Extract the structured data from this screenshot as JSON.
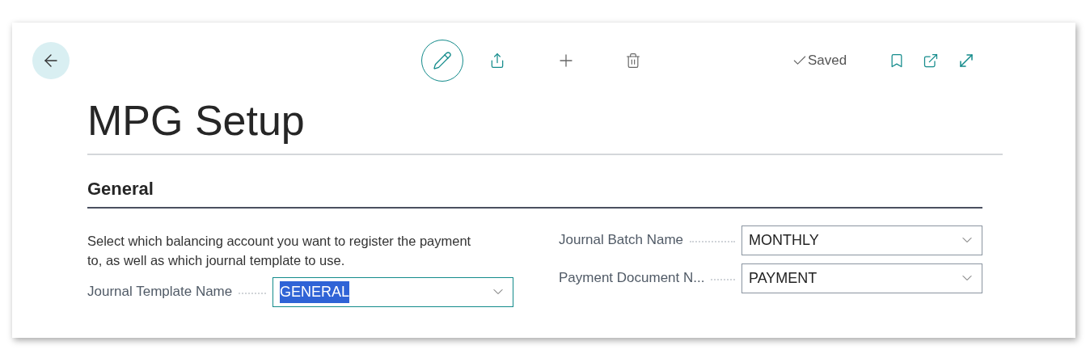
{
  "toolbar": {
    "status": "Saved"
  },
  "title": "MPG Setup",
  "section": {
    "heading": "General",
    "description": "Select which balancing account you want to register the payment to, as well as which journal template to use.",
    "left_fields": [
      {
        "label": "Journal Template Name",
        "value": "GENERAL",
        "focused": true
      }
    ],
    "right_fields": [
      {
        "label": "Journal Batch Name",
        "value": "MONTHLY",
        "focused": false
      },
      {
        "label": "Payment Document N...",
        "value": "PAYMENT",
        "focused": false
      }
    ]
  }
}
